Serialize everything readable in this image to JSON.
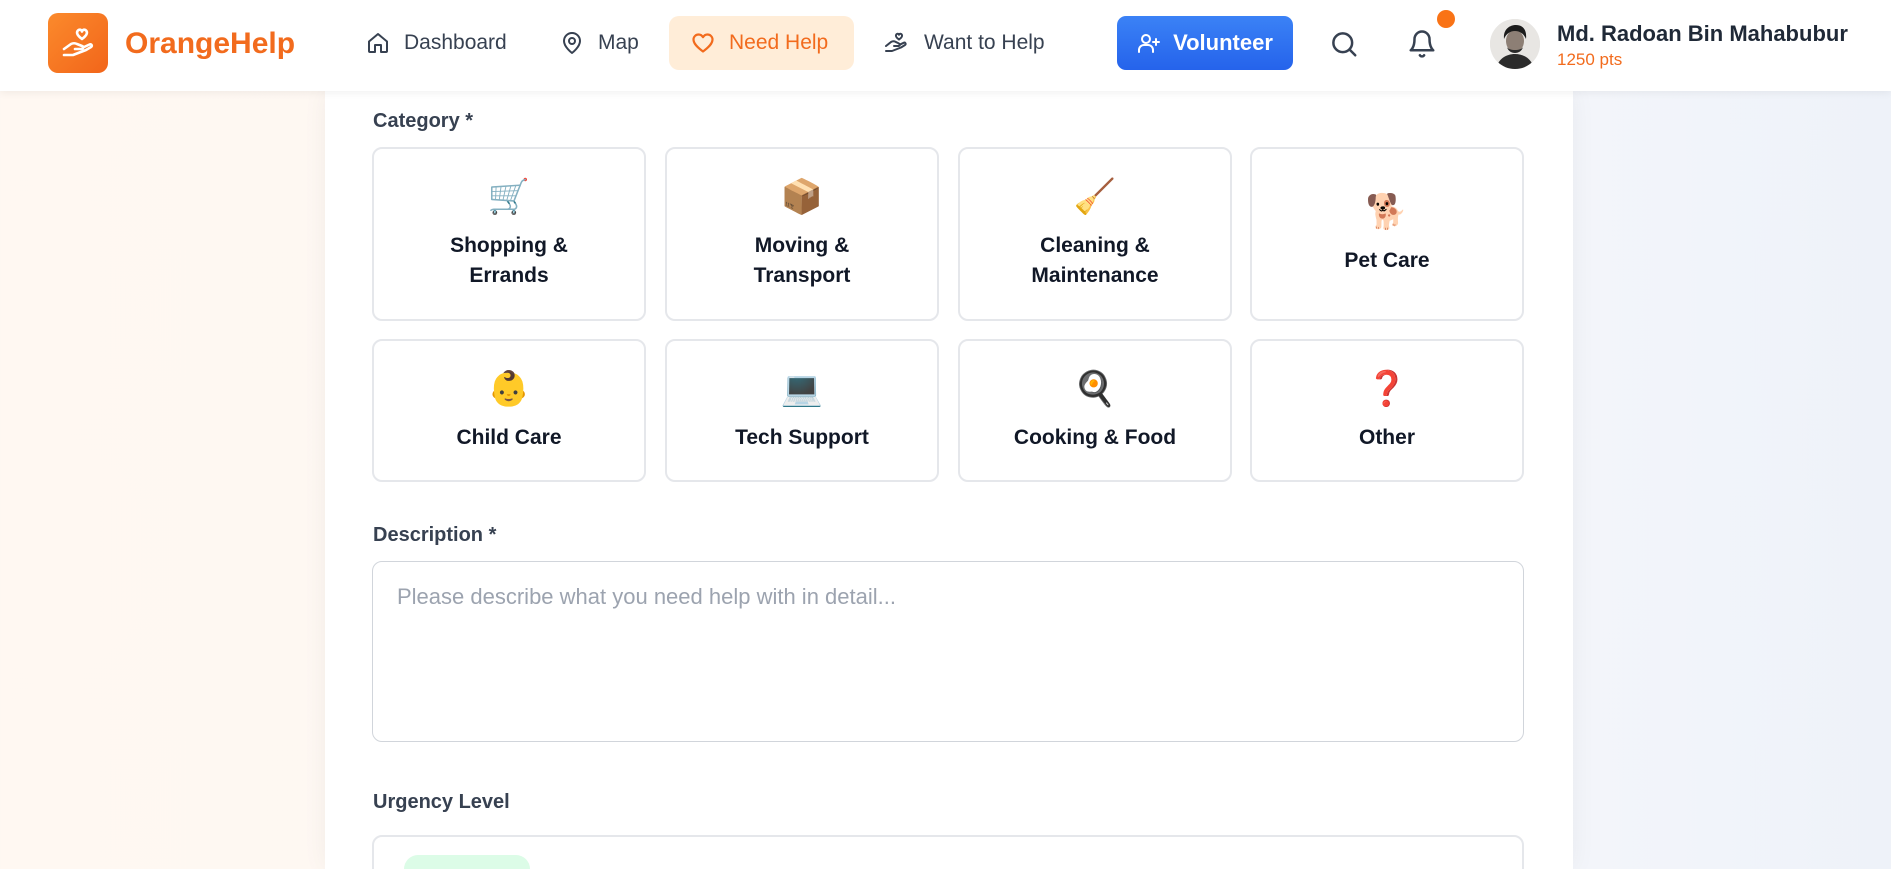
{
  "app": {
    "name": "OrangeHelp"
  },
  "nav": {
    "items": [
      {
        "label": "Dashboard",
        "icon": "home-icon",
        "active": false
      },
      {
        "label": "Map",
        "icon": "map-pin-icon",
        "active": false
      },
      {
        "label": "Need Help",
        "icon": "heart-icon",
        "active": true
      },
      {
        "label": "Want to Help",
        "icon": "helping-hand-icon",
        "active": false
      }
    ],
    "volunteer_label": "Volunteer"
  },
  "user": {
    "name": "Md. Radoan Bin Mahabubur",
    "points": "1250 pts",
    "has_notification": true
  },
  "form": {
    "category_label": "Category *",
    "categories": [
      {
        "label": "Shopping & Errands",
        "emoji": "🛒"
      },
      {
        "label": "Moving & Transport",
        "emoji": "📦"
      },
      {
        "label": "Cleaning & Maintenance",
        "emoji": "🧹"
      },
      {
        "label": "Pet Care",
        "emoji": "🐕"
      },
      {
        "label": "Child Care",
        "emoji": "👶"
      },
      {
        "label": "Tech Support",
        "emoji": "💻"
      },
      {
        "label": "Cooking & Food",
        "emoji": "🍳"
      },
      {
        "label": "Other",
        "emoji": "❓"
      }
    ],
    "description_label": "Description *",
    "description_placeholder": "Please describe what you need help with in detail...",
    "description_value": "",
    "urgency_label": "Urgency Level"
  },
  "colors": {
    "brand_orange": "#f26b1d",
    "active_nav_bg": "#ffedd8",
    "primary_blue": "#2563eb",
    "notification_dot": "#f97316"
  }
}
